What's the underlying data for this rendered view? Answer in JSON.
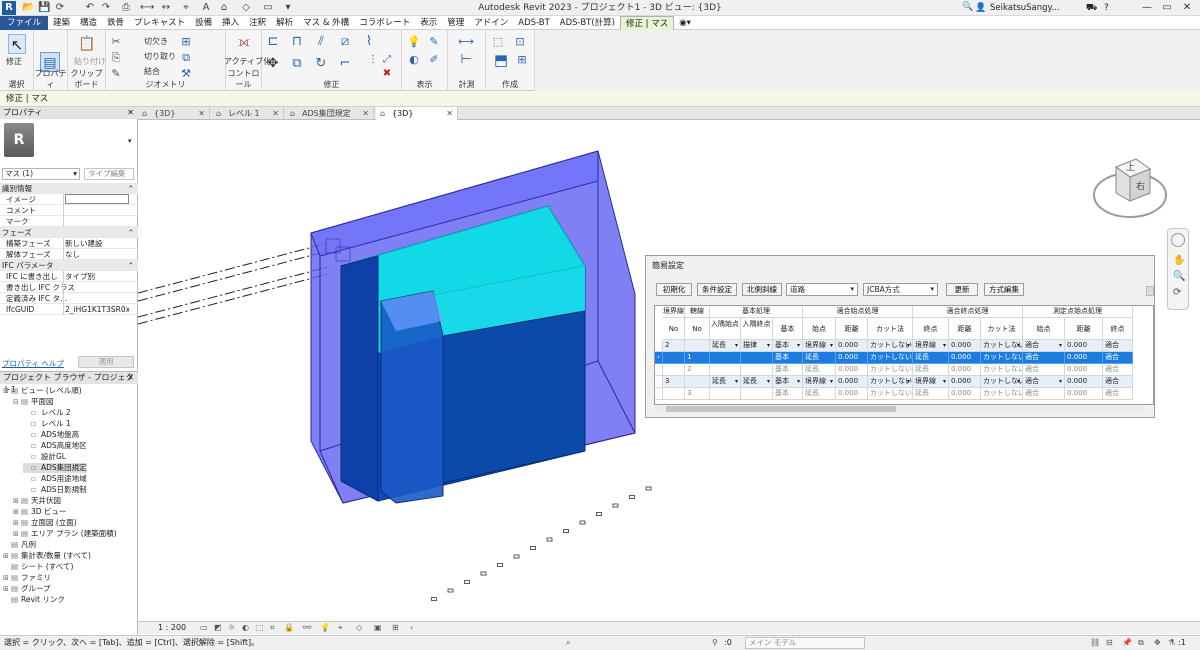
{
  "app": {
    "logo": "R",
    "title": "Autodesk Revit 2023 - プロジェクト1 - 3D ビュー: {3D}",
    "user": "SeikatsuSangy...",
    "colors": {
      "ribbon_active": "#2b5797",
      "selection": "#1c7ce0",
      "mass_blue": "#4b4ee0",
      "mass_cyan": "#10e0e8",
      "mass_dark": "#0d4aa8"
    }
  },
  "menu": {
    "tabs": [
      "ファイル",
      "建築",
      "構造",
      "鉄骨",
      "プレキャスト",
      "設備",
      "挿入",
      "注釈",
      "解析",
      "マス & 外構",
      "コラボレート",
      "表示",
      "管理",
      "アドイン",
      "ADS-BT",
      "ADS-BT(計算)",
      "修正 | マス"
    ]
  },
  "ribbon": {
    "select_label": "選択",
    "modify_label": "修正",
    "properties_label": "プロパティ",
    "paste_label": "貼り付け",
    "cut_label": "切欠き",
    "cut_remove_label": "切り取り",
    "join_label": "結合",
    "activate_label": "アクティブ化",
    "panels": {
      "select": "選択",
      "properties": "プロパティ",
      "clipboard": "クリップボード",
      "geometry": "ジオメトリ",
      "controls": "コントロール",
      "modify": "修正",
      "view": "表示",
      "measure": "計測",
      "create": "作成"
    }
  },
  "options_bar": {
    "text": "修正 | マス"
  },
  "view_tabs": [
    {
      "label": "{3D}",
      "active": false
    },
    {
      "label": "レベル 1",
      "active": false
    },
    {
      "label": "ADS集団規定",
      "active": false
    },
    {
      "label": "{3D}",
      "active": true
    }
  ],
  "properties": {
    "header": "プロパティ",
    "type_thumb": "R",
    "instance_selector": "マス (1)",
    "type_edit": "タイプ編集",
    "rows": [
      {
        "group": true,
        "k": "識別情報"
      },
      {
        "k": "イメージ",
        "v": ""
      },
      {
        "k": "コメント",
        "v": ""
      },
      {
        "k": "マーク",
        "v": ""
      },
      {
        "group": true,
        "k": "フェーズ"
      },
      {
        "k": "構築フェーズ",
        "v": "新しい建設"
      },
      {
        "k": "解体フェーズ",
        "v": "なし"
      },
      {
        "group": true,
        "k": "IFC パラメータ"
      },
      {
        "k": "IFC に書き出し",
        "v": "タイプ別"
      },
      {
        "k": "書き出し IFC クラス",
        "v": ""
      },
      {
        "k": "定義済み IFC タ...",
        "v": ""
      },
      {
        "k": "IfcGUID",
        "v": "2_iHG1K1T3SR0x..."
      }
    ],
    "help_link": "プロパティ ヘルプ",
    "apply": "適用"
  },
  "browser": {
    "header": "プロジェクト ブラウザ - プロジェクト1",
    "items": [
      {
        "label": "ビュー (レベル順)",
        "tog": "⊟",
        "lvl": 0
      },
      {
        "label": "平面図",
        "tog": "⊟",
        "lvl": 1
      },
      {
        "label": "レベル 2",
        "tog": "",
        "lvl": 2
      },
      {
        "label": "レベル 1",
        "tog": "",
        "lvl": 2
      },
      {
        "label": "ADS地盤高",
        "tog": "",
        "lvl": 2
      },
      {
        "label": "ADS高度地区",
        "tog": "",
        "lvl": 2
      },
      {
        "label": "設計GL",
        "tog": "",
        "lvl": 2
      },
      {
        "label": "ADS集団規定",
        "tog": "",
        "lvl": 2
      },
      {
        "label": "ADS用途地域",
        "tog": "",
        "lvl": 2
      },
      {
        "label": "ADS日影規制",
        "tog": "",
        "lvl": 2
      },
      {
        "label": "天井伏図",
        "tog": "⊞",
        "lvl": 1
      },
      {
        "label": "3D ビュー",
        "tog": "⊞",
        "lvl": 1
      },
      {
        "label": "立面図 (立面)",
        "tog": "⊞",
        "lvl": 1
      },
      {
        "label": "エリア プラン (建築面積)",
        "tog": "⊞",
        "lvl": 1
      },
      {
        "label": "凡例",
        "tog": "",
        "lvl": 0
      },
      {
        "label": "集計表/数量 (すべて)",
        "tog": "⊞",
        "lvl": 0
      },
      {
        "label": "シート (すべて)",
        "tog": "",
        "lvl": 0
      },
      {
        "label": "ファミリ",
        "tog": "⊞",
        "lvl": 0
      },
      {
        "label": "グループ",
        "tog": "⊞",
        "lvl": 0
      },
      {
        "label": "Revit リンク",
        "tog": "",
        "lvl": 0
      }
    ]
  },
  "dialog": {
    "title": "簡易設定",
    "buttons": [
      "初期化",
      "条件設定",
      "北側斜線"
    ],
    "road_select": "道路",
    "method_select": "JCBA方式",
    "update": "更新",
    "method_edit": "方式編集",
    "header1": [
      "境界線",
      "轄線",
      "基本処理",
      "適合始点処理",
      "適合終点処理",
      "測定点始点処理"
    ],
    "header2": [
      "No",
      "No",
      "入隅始点",
      "入隅終点",
      "基本",
      "始点",
      "距離",
      "カット法",
      "終点",
      "距離",
      "カット法",
      "始点",
      "距離",
      "終点"
    ],
    "rows": [
      {
        "kind": "main",
        "cells": [
          "2",
          "",
          "延長",
          "描律",
          "基本",
          "境界線",
          "0.000",
          "カットしない",
          "境界線",
          "0.000",
          "カットしない",
          "適合",
          "0.000",
          "適合"
        ]
      },
      {
        "kind": "sel",
        "cells": [
          "",
          "1",
          "",
          "",
          "基本",
          "延長",
          "0.000",
          "カットしない",
          "延長",
          "0.000",
          "カットしない",
          "適合",
          "0.000",
          "適合"
        ]
      },
      {
        "kind": "dim",
        "cells": [
          "",
          "2",
          "",
          "",
          "基本",
          "延長",
          "0.000",
          "カットしない",
          "延長",
          "0.000",
          "カットしない",
          "適合",
          "0.000",
          "適合"
        ]
      },
      {
        "kind": "main",
        "cells": [
          "3",
          "",
          "延長",
          "延長",
          "基本",
          "境界線",
          "0.000",
          "カットしない",
          "境界線",
          "0.000",
          "カットしない",
          "適合",
          "0.000",
          "適合"
        ]
      },
      {
        "kind": "dim",
        "cells": [
          "",
          "3",
          "",
          "",
          "基本",
          "延長",
          "0.000",
          "カットしない",
          "延長",
          "0.000",
          "カットしない",
          "適合",
          "0.000",
          "適合"
        ]
      }
    ]
  },
  "viewcube": {
    "face": "上",
    "face2": "右"
  },
  "view_control": {
    "scale": "1 : 200"
  },
  "status": {
    "hint": "選択 = クリック、次へ = [Tab]、追加 = [Ctrl]、選択解除 = [Shift]。",
    "coord": ":0",
    "model": "メイン モデル",
    "filter": ":1"
  }
}
